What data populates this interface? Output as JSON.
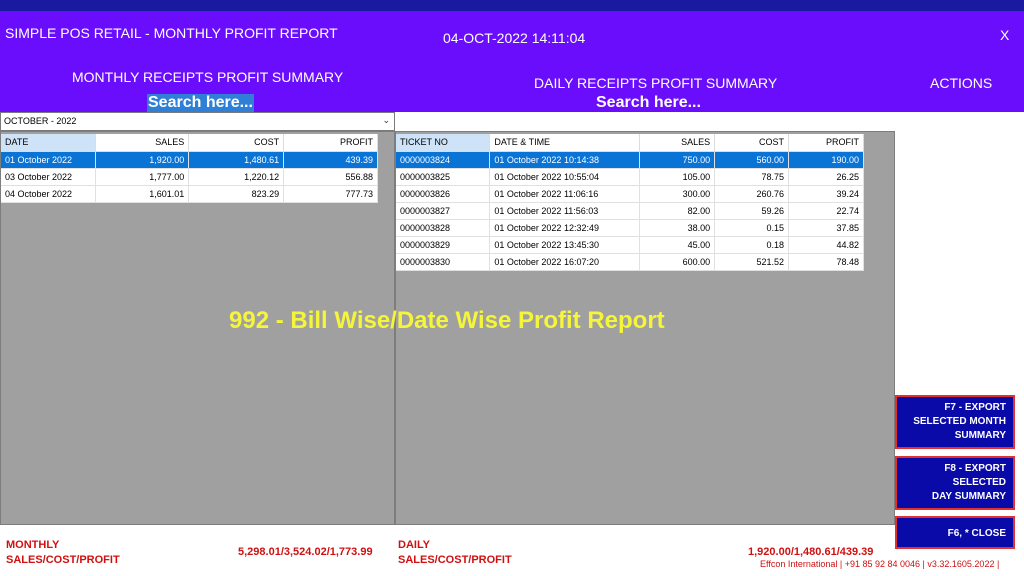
{
  "header": {
    "app_title": "SIMPLE POS RETAIL - MONTHLY PROFIT REPORT",
    "datetime": "04-OCT-2022 14:11:04",
    "close_label": "X",
    "monthly_title": "MONTHLY RECEIPTS PROFIT SUMMARY",
    "daily_title": "DAILY RECEIPTS PROFIT SUMMARY",
    "actions_title": "ACTIONS",
    "search_left": "Search here...",
    "search_right": "Search here..."
  },
  "month_select": {
    "value": "OCTOBER - 2022"
  },
  "monthly": {
    "headers": [
      "DATE",
      "SALES",
      "COST",
      "PROFIT"
    ],
    "rows": [
      [
        "01 October 2022",
        "1,920.00",
        "1,480.61",
        "439.39"
      ],
      [
        "03 October 2022",
        "1,777.00",
        "1,220.12",
        "556.88"
      ],
      [
        "04 October 2022",
        "1,601.01",
        "823.29",
        "777.73"
      ]
    ]
  },
  "daily": {
    "headers": [
      "TICKET NO",
      "DATE & TIME",
      "SALES",
      "COST",
      "PROFIT"
    ],
    "rows": [
      [
        "0000003824",
        "01 October 2022  10:14:38",
        "750.00",
        "560.00",
        "190.00"
      ],
      [
        "0000003825",
        "01 October 2022  10:55:04",
        "105.00",
        "78.75",
        "26.25"
      ],
      [
        "0000003826",
        "01 October 2022  11:06:16",
        "300.00",
        "260.76",
        "39.24"
      ],
      [
        "0000003827",
        "01 October 2022  11:56:03",
        "82.00",
        "59.26",
        "22.74"
      ],
      [
        "0000003828",
        "01 October 2022  12:32:49",
        "38.00",
        "0.15",
        "37.85"
      ],
      [
        "0000003829",
        "01 October 2022  13:45:30",
        "45.00",
        "0.18",
        "44.82"
      ],
      [
        "0000003830",
        "01 October 2022  16:07:20",
        "600.00",
        "521.52",
        "78.48"
      ]
    ]
  },
  "watermark": "992 - Bill Wise/Date Wise Profit Report",
  "actions": {
    "export_month": [
      "F7 - EXPORT",
      "SELECTED MONTH",
      "SUMMARY"
    ],
    "export_day": [
      "F8 - EXPORT",
      "SELECTED",
      "DAY SUMMARY"
    ],
    "close": "F6, * CLOSE"
  },
  "footer": {
    "monthly_label": [
      "MONTHLY",
      "SALES/COST/PROFIT"
    ],
    "monthly_value": "5,298.01/3,524.02/1,773.99",
    "daily_label": [
      "DAILY",
      "SALES/COST/PROFIT"
    ],
    "daily_value": "1,920.00/1,480.61/439.39",
    "credits": "Effcon International | +91 85 92 84 0046 | v3.32.1605.2022 |"
  },
  "colors": {
    "header_bg": "#6a0dfc",
    "top_strip": "#1a1aa0",
    "selected_row": "#0a74d6",
    "action_button_bg": "#0a0aa8",
    "footer_text": "#d01010",
    "watermark": "#f5f53a"
  }
}
